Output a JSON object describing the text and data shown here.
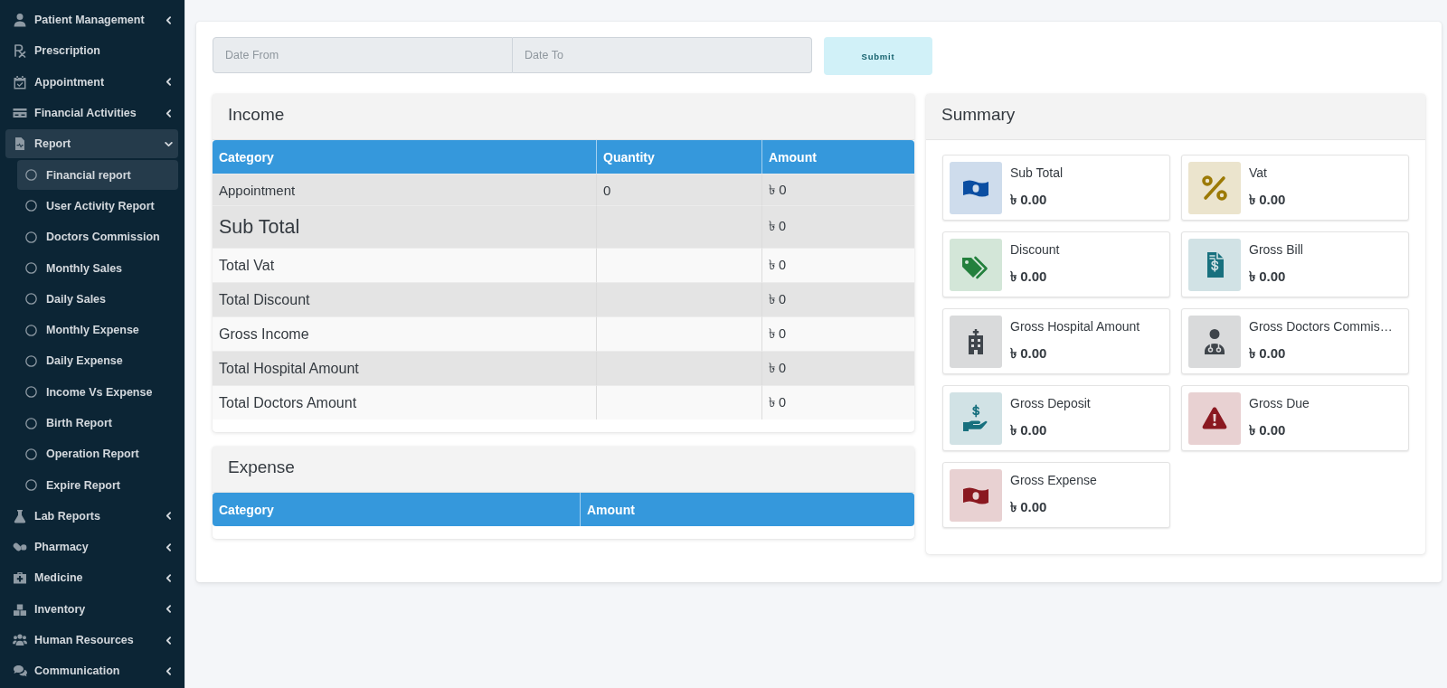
{
  "sidebar": {
    "items": [
      {
        "label": "Patient Management",
        "kind": "group",
        "expanded": false,
        "selected": false
      },
      {
        "label": "Prescription",
        "kind": "link",
        "selected": false
      },
      {
        "label": "Appointment",
        "kind": "group",
        "expanded": false,
        "selected": false
      },
      {
        "label": "Financial Activities",
        "kind": "group",
        "expanded": false,
        "selected": false
      },
      {
        "label": "Report",
        "kind": "group",
        "expanded": true,
        "selected": true,
        "children": [
          {
            "label": "Financial report",
            "selected": true
          },
          {
            "label": "User Activity Report",
            "selected": false
          },
          {
            "label": "Doctors Commission",
            "selected": false
          },
          {
            "label": "Monthly Sales",
            "selected": false
          },
          {
            "label": "Daily Sales",
            "selected": false
          },
          {
            "label": "Monthly Expense",
            "selected": false
          },
          {
            "label": "Daily Expense",
            "selected": false
          },
          {
            "label": "Income Vs Expense",
            "selected": false
          },
          {
            "label": "Birth Report",
            "selected": false
          },
          {
            "label": "Operation Report",
            "selected": false
          },
          {
            "label": "Expire Report",
            "selected": false
          }
        ]
      },
      {
        "label": "Lab Reports",
        "kind": "group",
        "expanded": false,
        "selected": false
      },
      {
        "label": "Pharmacy",
        "kind": "group",
        "expanded": false,
        "selected": false
      },
      {
        "label": "Medicine",
        "kind": "group",
        "expanded": false,
        "selected": false
      },
      {
        "label": "Inventory",
        "kind": "group",
        "expanded": false,
        "selected": false
      },
      {
        "label": "Human Resources",
        "kind": "group",
        "expanded": false,
        "selected": false
      },
      {
        "label": "Communication",
        "kind": "group",
        "expanded": false,
        "selected": false
      }
    ]
  },
  "filter": {
    "date_from": {
      "placeholder": "Date From"
    },
    "date_to": {
      "placeholder": "Date To"
    },
    "submit": "Submit"
  },
  "income": {
    "title": "Income",
    "columns": [
      "Category",
      "Quantity",
      "Amount"
    ],
    "rows": [
      {
        "category": "Appointment",
        "quantity": "0",
        "amount": "৳ 0"
      }
    ],
    "totals": [
      {
        "label": "Sub Total",
        "kind": "subtotal",
        "amount": "৳ 0"
      },
      {
        "label": "Total Vat",
        "kind": "total",
        "amount": "৳ 0"
      },
      {
        "label": "Total Discount",
        "kind": "total",
        "amount": "৳ 0"
      },
      {
        "label": "Gross Income",
        "kind": "total",
        "amount": "৳ 0"
      },
      {
        "label": "Total Hospital Amount",
        "kind": "total",
        "amount": "৳ 0"
      },
      {
        "label": "Total Doctors Amount",
        "kind": "total",
        "amount": "৳ 0"
      }
    ]
  },
  "expense": {
    "title": "Expense",
    "columns": [
      "Category",
      "Amount"
    ]
  },
  "summary": {
    "title": "Summary",
    "items": [
      {
        "label": "Sub Total",
        "value": "৳ 0.00",
        "color": "#0b4ea2"
      },
      {
        "label": "Vat",
        "value": "৳ 0.00",
        "color": "#9c7a06"
      },
      {
        "label": "Discount",
        "value": "৳ 0.00",
        "color": "#23803d"
      },
      {
        "label": "Gross Bill",
        "value": "৳ 0.00",
        "color": "#17707e"
      },
      {
        "label": "Gross Hospital Amount",
        "value": "৳ 0.00",
        "color": "#3f454b"
      },
      {
        "label": "Gross Doctors Commis…",
        "value": "৳ 0.00",
        "color": "#3f454b"
      },
      {
        "label": "Gross Deposit",
        "value": "৳ 0.00",
        "color": "#17707e"
      },
      {
        "label": "Gross Due",
        "value": "৳ 0.00",
        "color": "#8a1820"
      },
      {
        "label": "Gross Expense",
        "value": "৳ 0.00",
        "color": "#8a1820"
      }
    ]
  }
}
